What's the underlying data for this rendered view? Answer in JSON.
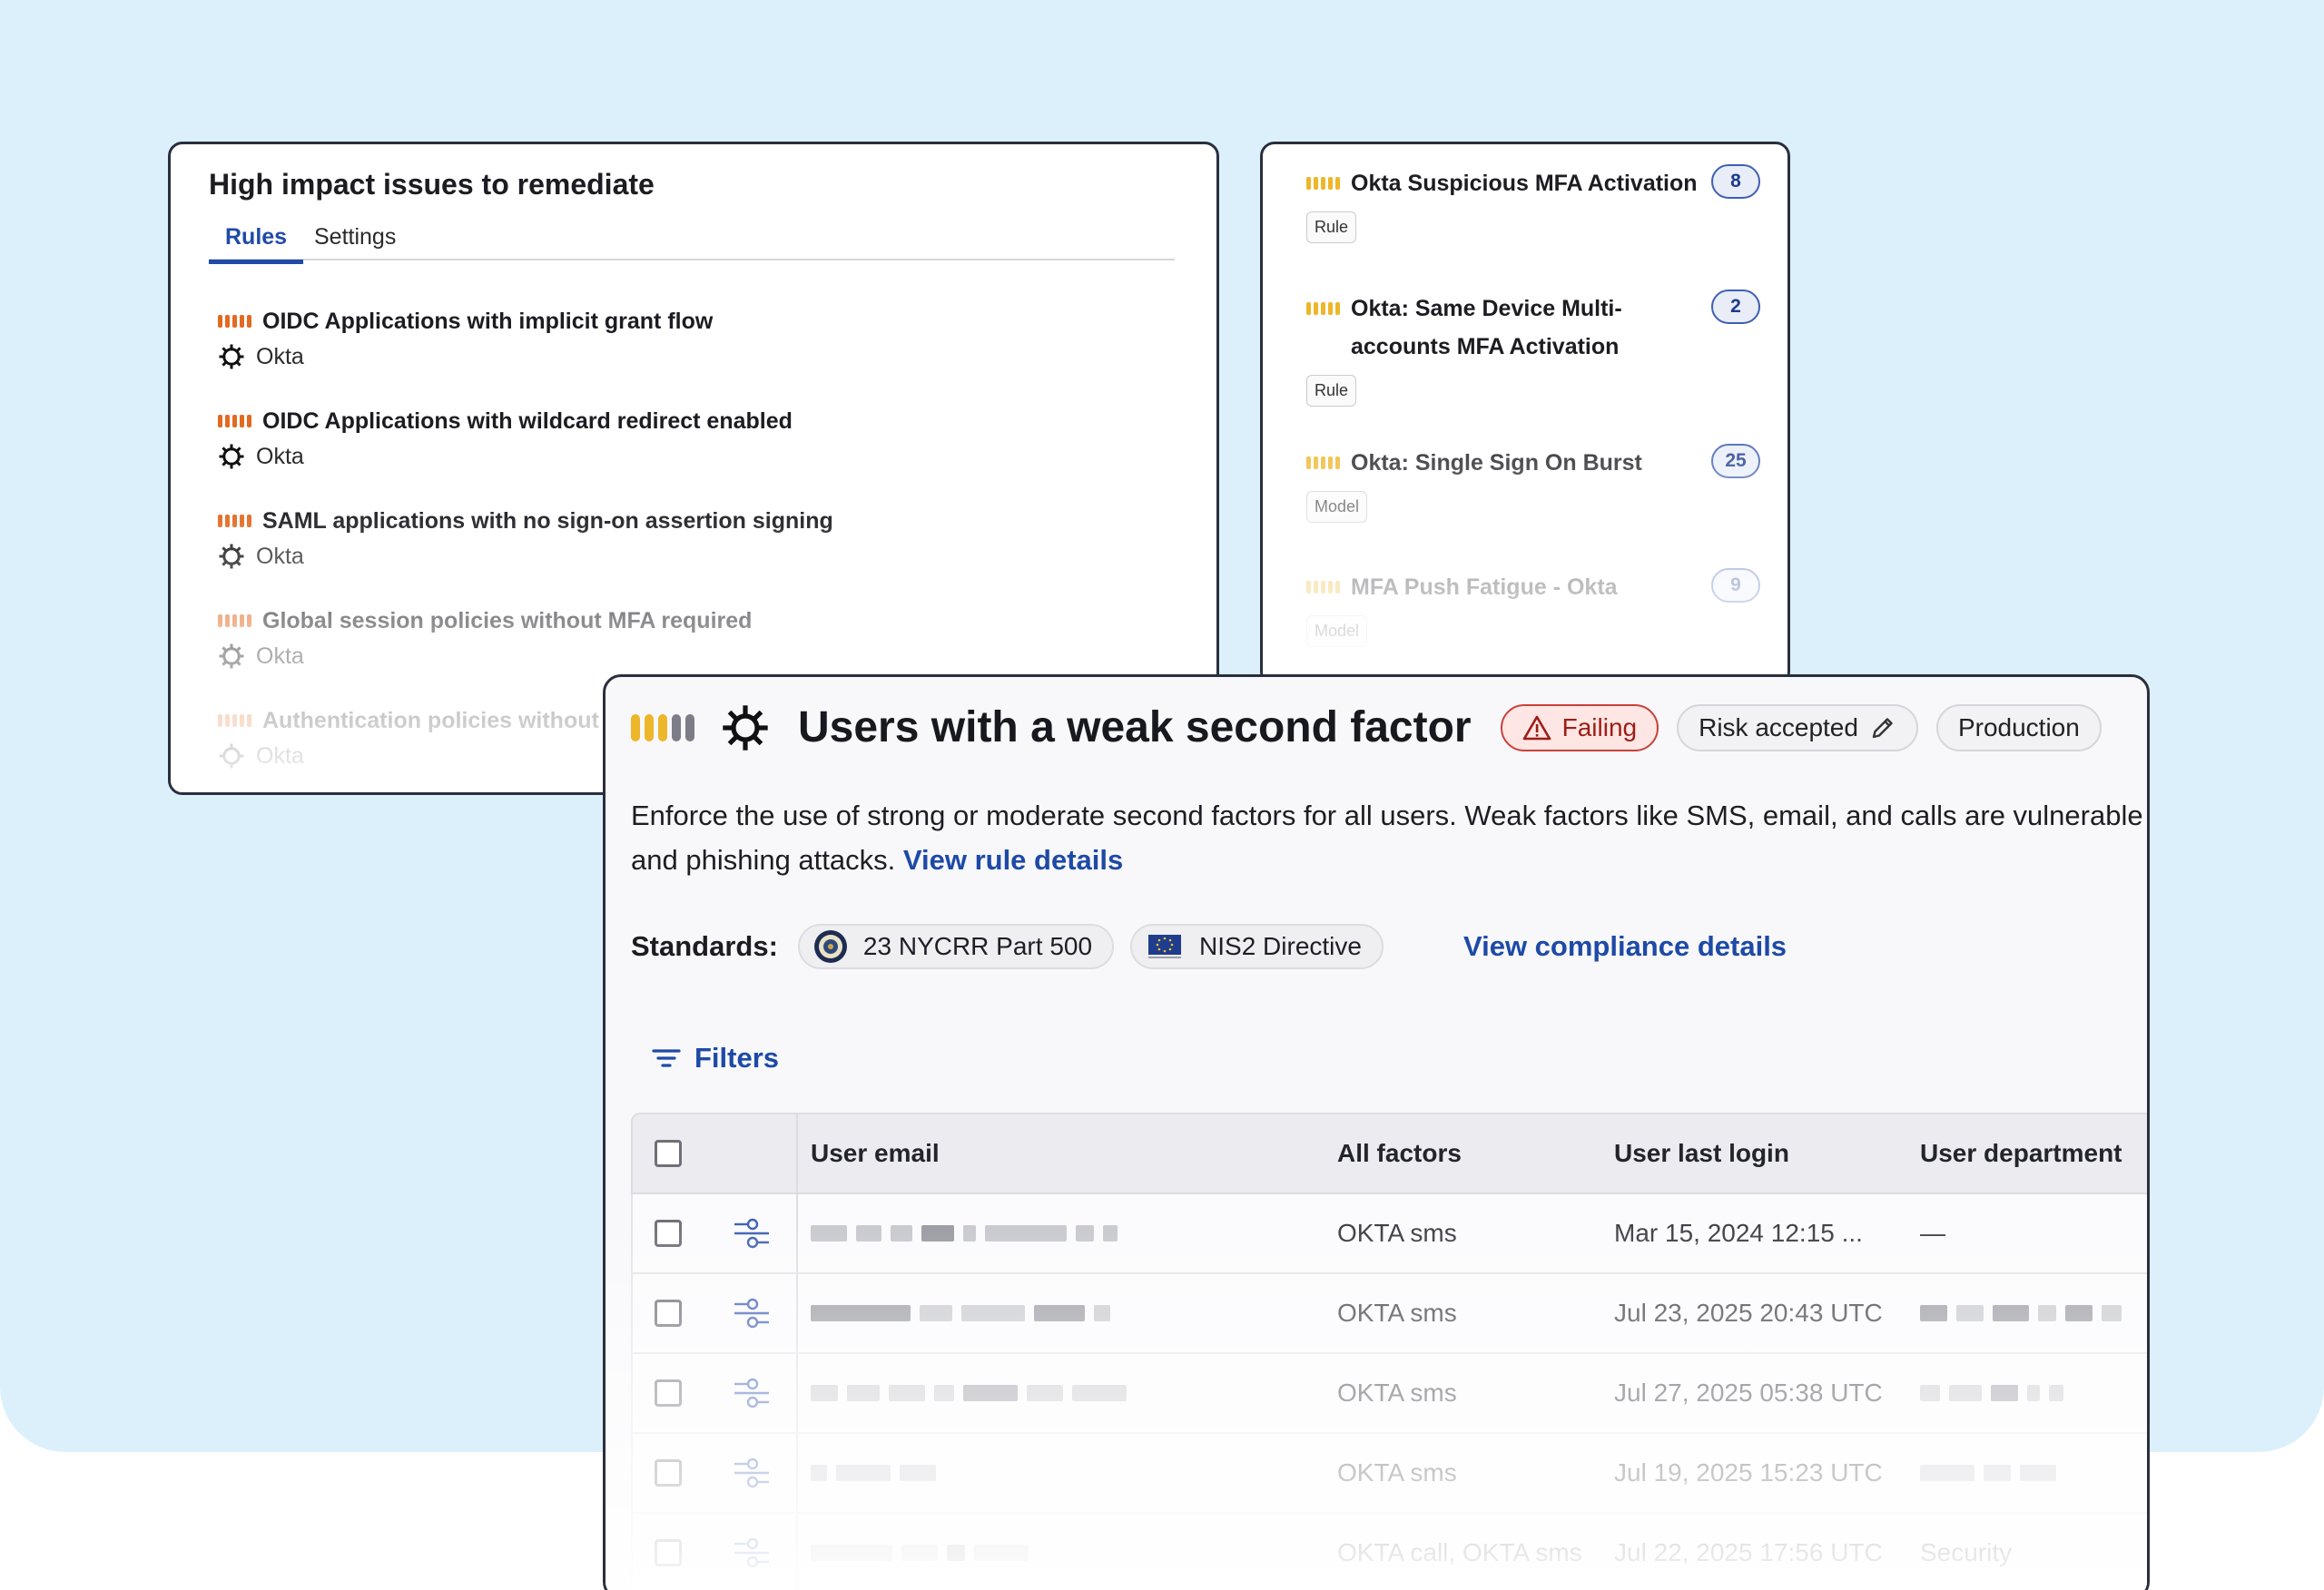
{
  "colors": {
    "background": "#dcf0fc",
    "link": "#1e4aa6",
    "severity_high": "#e26a22",
    "severity_medium": "#eeb62b",
    "failing": "#c9413a"
  },
  "issues_panel": {
    "title": "High impact issues to remediate",
    "tabs": [
      "Rules",
      "Settings"
    ],
    "active_tab": "Rules",
    "items": [
      {
        "title": "OIDC Applications with implicit grant flow",
        "source": "Okta",
        "icon": "okta-icon"
      },
      {
        "title": "OIDC Applications with wildcard redirect enabled",
        "source": "Okta",
        "icon": "okta-icon"
      },
      {
        "title": "SAML applications with no sign-on assertion signing",
        "source": "Okta",
        "icon": "okta-icon"
      },
      {
        "title": "Global session policies without MFA required",
        "source": "Okta",
        "icon": "okta-icon"
      },
      {
        "title": "Authentication policies without p",
        "source": "Okta",
        "icon": "okta-icon"
      }
    ]
  },
  "alerts_panel": {
    "items": [
      {
        "title": "Okta Suspicious MFA Activation",
        "count": "8",
        "kind": "Rule"
      },
      {
        "title": "Okta: Same Device Multi-accounts MFA Activation",
        "count": "2",
        "kind": "Rule"
      },
      {
        "title": "Okta: Single Sign On Burst",
        "count": "25",
        "kind": "Model"
      },
      {
        "title": "MFA Push Fatigue - Okta",
        "count": "9",
        "kind": "Model"
      }
    ]
  },
  "rule": {
    "title": "Users with a weak second factor",
    "status": "Failing",
    "risk_label": "Risk accepted",
    "environment": "Production",
    "description_line1": "Enforce the use of strong or moderate second factors for all users. Weak factors like SMS, email, and calls are vulnerable",
    "description_line2": "and phishing attacks.",
    "details_link": "View rule details",
    "standards_label": "Standards:",
    "standards": [
      {
        "name": "23 NYCRR Part 500",
        "icon": "nydfs-seal-icon"
      },
      {
        "name": "NIS2 Directive",
        "icon": "eu-flag-icon"
      }
    ],
    "compliance_link": "View compliance details",
    "filters_label": "Filters"
  },
  "table": {
    "columns": [
      "User email",
      "All factors",
      "User last login",
      "User department"
    ],
    "rows": [
      {
        "factors": "OKTA sms",
        "last_login": "Mar 15, 2024 12:15 ...",
        "department": "—"
      },
      {
        "factors": "OKTA sms",
        "last_login": "Jul 23, 2025 20:43 UTC",
        "department": ""
      },
      {
        "factors": "OKTA sms",
        "last_login": "Jul 27, 2025 05:38 UTC",
        "department": ""
      },
      {
        "factors": "OKTA sms",
        "last_login": "Jul 19, 2025 15:23 UTC",
        "department": ""
      },
      {
        "factors": "OKTA call, OKTA sms",
        "last_login": "Jul 22, 2025 17:56 UTC",
        "department": "Security"
      }
    ]
  }
}
